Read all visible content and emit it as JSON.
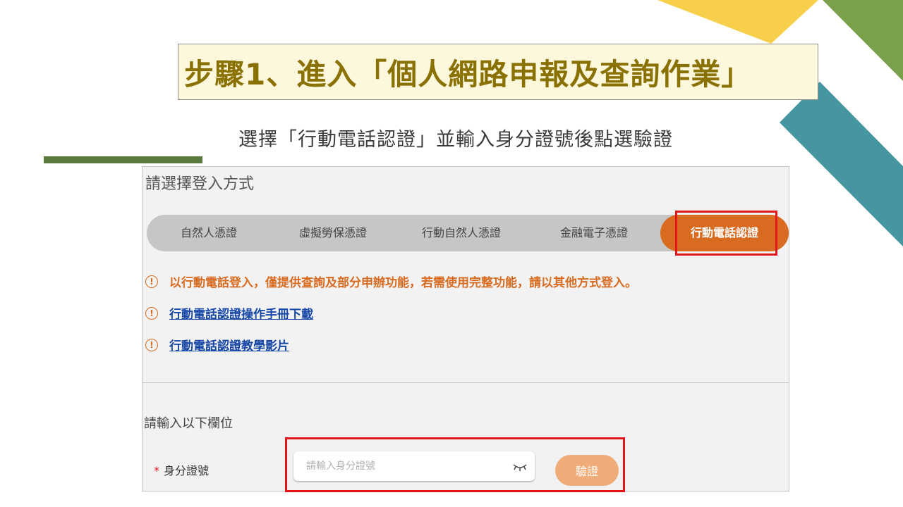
{
  "slide": {
    "title": "步驟1、進入「個人網路申報及查詢作業」",
    "subtitle": "選擇「行動電話認證」並輸入身分證號後點選驗證"
  },
  "login": {
    "heading": "請選擇登入方式",
    "tabs": [
      {
        "label": "自然人憑證",
        "active": false
      },
      {
        "label": "虛擬勞保憑證",
        "active": false
      },
      {
        "label": "行動自然人憑證",
        "active": false
      },
      {
        "label": "金融電子憑證",
        "active": false
      },
      {
        "label": "行動電話認證",
        "active": true
      }
    ],
    "warning": "以行動電話登入，僅提供查詢及部分申辦功能，若需使用完整功能，請以其他方式登入。",
    "links": [
      "行動電話認證操作手冊下載",
      "行動電話認證教學影片"
    ],
    "info_icon": "!"
  },
  "form": {
    "section_label": "請輸入以下欄位",
    "required_mark": "*",
    "id_label": "身分證號",
    "id_placeholder": "請輸入身分證號",
    "id_value": "",
    "verify_label": "驗證"
  },
  "colors": {
    "accent_orange": "#d86b1f",
    "highlight_red": "#e3161b",
    "link_blue": "#1747a6",
    "title_gold": "#8a7104"
  }
}
